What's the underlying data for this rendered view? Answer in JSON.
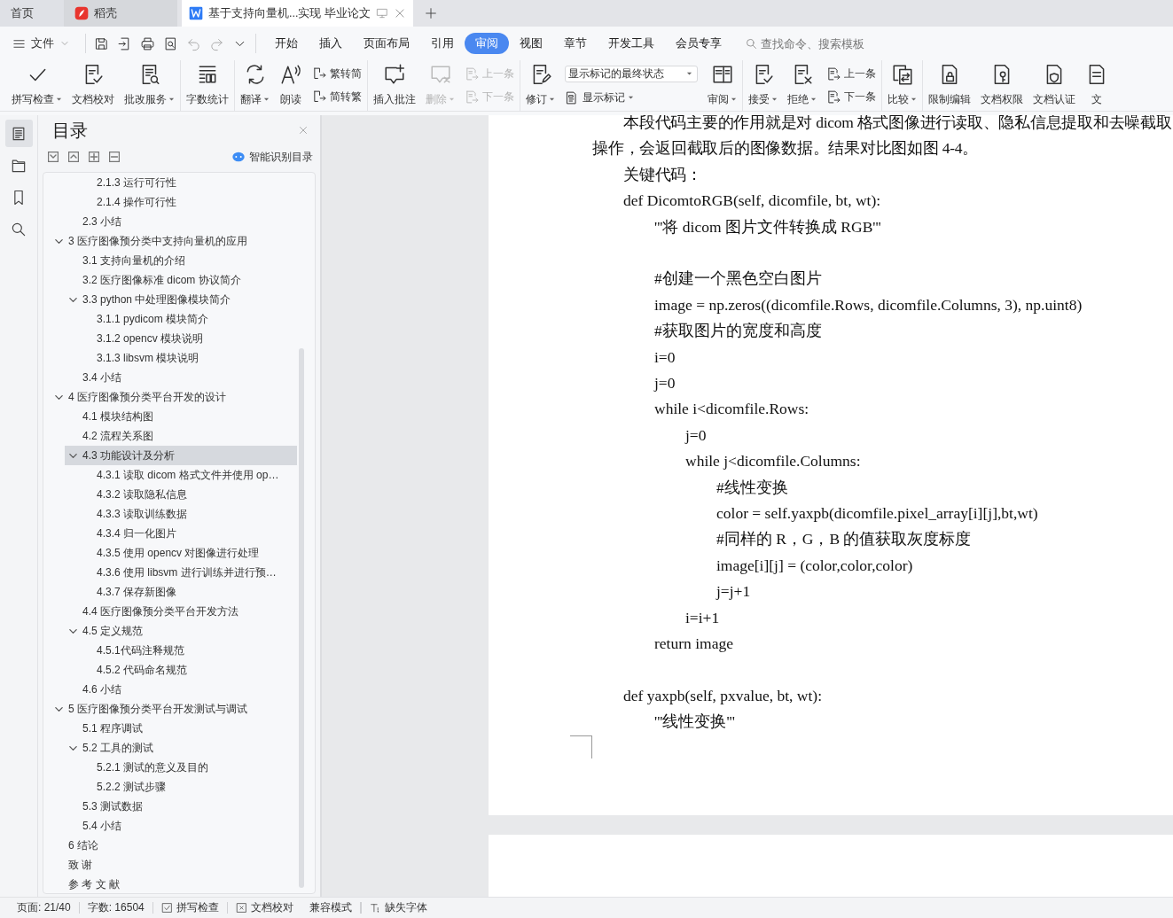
{
  "tabs": [
    {
      "label": "首页",
      "kind": "home",
      "selected": false
    },
    {
      "label": "稻壳",
      "kind": "docer",
      "selected": false
    },
    {
      "label": "基于支持向量机...实现 毕业论文",
      "kind": "doc",
      "selected": true
    }
  ],
  "menu": {
    "file": "文件",
    "tabs": [
      {
        "label": "开始",
        "selected": false
      },
      {
        "label": "插入",
        "selected": false
      },
      {
        "label": "页面布局",
        "selected": false
      },
      {
        "label": "引用",
        "selected": false
      },
      {
        "label": "审阅",
        "selected": true
      },
      {
        "label": "视图",
        "selected": false
      },
      {
        "label": "章节",
        "selected": false
      },
      {
        "label": "开发工具",
        "selected": false
      },
      {
        "label": "会员专享",
        "selected": false
      }
    ],
    "search": {
      "placeholder": "查找命令、搜索模板"
    }
  },
  "ribbon": {
    "groups": [
      {
        "tools": [
          {
            "kind": "large",
            "label": "拼写检查",
            "dropdown": true,
            "disabled": false
          },
          {
            "kind": "large",
            "label": "文档校对",
            "dropdown": false,
            "disabled": false
          },
          {
            "kind": "large",
            "label": "批改服务",
            "dropdown": true,
            "disabled": false
          }
        ]
      },
      {
        "tools": [
          {
            "kind": "large",
            "label": "字数统计",
            "dropdown": false,
            "disabled": false
          }
        ]
      },
      {
        "tools": [
          {
            "kind": "large",
            "label": "翻译",
            "dropdown": true,
            "disabled": false
          },
          {
            "kind": "large",
            "label": "朗读",
            "dropdown": false,
            "disabled": false
          },
          {
            "kind": "stack",
            "items": [
              {
                "kind": "small",
                "label": "繁转简",
                "dropdown": false,
                "disabled": false
              },
              {
                "kind": "small",
                "label": "简转繁",
                "dropdown": false,
                "disabled": false
              }
            ]
          }
        ]
      },
      {
        "tools": [
          {
            "kind": "large",
            "label": "插入批注",
            "dropdown": false,
            "disabled": false
          },
          {
            "kind": "large",
            "label": "删除",
            "dropdown": true,
            "disabled": true
          },
          {
            "kind": "stack",
            "items": [
              {
                "kind": "small",
                "label": "上一条",
                "dropdown": false,
                "disabled": true
              },
              {
                "kind": "small",
                "label": "下一条",
                "dropdown": false,
                "disabled": true
              }
            ]
          }
        ]
      },
      {
        "tools": [
          {
            "kind": "large",
            "label": "修订",
            "dropdown": true,
            "disabled": false
          },
          {
            "kind": "stack",
            "items": [
              {
                "kind": "select",
                "value": "显示标记的最终状态"
              },
              {
                "kind": "small",
                "label": "显示标记",
                "dropdown": true,
                "disabled": false
              }
            ]
          },
          {
            "kind": "large",
            "label": "审阅",
            "dropdown": true,
            "disabled": false
          }
        ]
      },
      {
        "tools": [
          {
            "kind": "large",
            "label": "接受",
            "dropdown": true,
            "disabled": false
          },
          {
            "kind": "large",
            "label": "拒绝",
            "dropdown": true,
            "disabled": false
          },
          {
            "kind": "stack",
            "items": [
              {
                "kind": "small",
                "label": "上一条",
                "dropdown": false,
                "disabled": false
              },
              {
                "kind": "small",
                "label": "下一条",
                "dropdown": false,
                "disabled": false
              }
            ]
          }
        ]
      },
      {
        "tools": [
          {
            "kind": "large",
            "label": "比较",
            "dropdown": true,
            "disabled": false
          }
        ]
      },
      {
        "tools": [
          {
            "kind": "large",
            "label": "限制编辑",
            "dropdown": false,
            "disabled": false
          },
          {
            "kind": "large",
            "label": "文档权限",
            "dropdown": false,
            "disabled": false
          },
          {
            "kind": "large",
            "label": "文档认证",
            "dropdown": false,
            "disabled": false
          },
          {
            "kind": "large",
            "label": "文",
            "dropdown": false,
            "disabled": false
          }
        ]
      }
    ]
  },
  "nav": [
    {
      "selected": true
    },
    {
      "selected": false
    },
    {
      "selected": false
    },
    {
      "selected": false
    }
  ],
  "toc": {
    "title": "目录",
    "smart": "智能识别目录",
    "items": [
      {
        "children": [
          {
            "children": [
              {
                "label": "2.1.3 运行可行性",
                "selected": false
              },
              {
                "label": "2.1.4 操作可行性",
                "selected": false
              }
            ]
          },
          {
            "label": "2.3 小结",
            "selected": false
          }
        ]
      },
      {
        "label": "3 医疗图像预分类中支持向量机的应用",
        "selected": false,
        "expanded": true,
        "children": [
          {
            "label": "3.1 支持向量机的介绍",
            "selected": false
          },
          {
            "label": "3.2 医疗图像标准 dicom 协议简介",
            "selected": false
          },
          {
            "label": "3.3 python 中处理图像模块简介",
            "selected": false,
            "expanded": true,
            "children": [
              {
                "label": "3.1.1 pydicom 模块简介",
                "selected": false
              },
              {
                "label": "3.1.2 opencv 模块说明",
                "selected": false
              },
              {
                "label": "3.1.3 libsvm 模块说明",
                "selected": false
              }
            ]
          },
          {
            "label": "3.4 小结",
            "selected": false
          }
        ]
      },
      {
        "label": "4 医疗图像预分类平台开发的设计",
        "selected": false,
        "expanded": true,
        "children": [
          {
            "label": "4.1 模块结构图",
            "selected": false
          },
          {
            "label": "4.2 流程关系图",
            "selected": false
          },
          {
            "label": "4.3 功能设计及分析",
            "selected": true,
            "expanded": true,
            "children": [
              {
                "label": "4.3.1 读取 dicom 格式文件并使用 op…",
                "selected": false
              },
              {
                "label": "4.3.2 读取隐私信息",
                "selected": false
              },
              {
                "label": "4.3.3 读取训练数据",
                "selected": false
              },
              {
                "label": "4.3.4 归一化图片",
                "selected": false
              },
              {
                "label": "4.3.5 使用 opencv 对图像进行处理",
                "selected": false
              },
              {
                "label": "4.3.6 使用 libsvm 进行训练并进行预…",
                "selected": false
              },
              {
                "label": "4.3.7 保存新图像",
                "selected": false
              }
            ]
          },
          {
            "label": "4.4 医疗图像预分类平台开发方法",
            "selected": false
          },
          {
            "label": "4.5 定义规范",
            "selected": false,
            "expanded": true,
            "children": [
              {
                "label": "4.5.1代码注释规范",
                "selected": false
              },
              {
                "label": "4.5.2 代码命名规范",
                "selected": false
              }
            ]
          },
          {
            "label": "4.6 小结",
            "selected": false
          }
        ]
      },
      {
        "label": "5 医疗图像预分类平台开发测试与调试",
        "selected": false,
        "expanded": true,
        "children": [
          {
            "label": "5.1 程序调试",
            "selected": false
          },
          {
            "label": "5.2 工具的测试",
            "selected": false,
            "expanded": true,
            "children": [
              {
                "label": "5.2.1 测试的意义及目的",
                "selected": false
              },
              {
                "label": "5.2.2 测试步骤",
                "selected": false
              }
            ]
          },
          {
            "label": "5.3 测试数据",
            "selected": false
          },
          {
            "label": "5.4 小结",
            "selected": false
          }
        ]
      },
      {
        "label": "6 结论",
        "selected": false
      },
      {
        "label": "致 谢",
        "selected": false
      },
      {
        "label": "参 考 文 献",
        "selected": false
      }
    ]
  },
  "document": {
    "lines": [
      {
        "kind": "para",
        "text": "本段代码主要的作用就是对 dicom 格式图像进行读取、隐私信息提取和去噪截取操作，会返回截取后的图像数据。结果对比图如图 4-4。"
      },
      {
        "kind": "para",
        "text": "关键代码："
      },
      {
        "kind": "code",
        "text": "def DicomtoRGB(self, dicomfile, bt, wt):",
        "children": [
          {
            "kind": "code",
            "text": "'''将 dicom 图片文件转换成 RGB'''"
          },
          {
            "kind": "blank"
          },
          {
            "kind": "code",
            "text": "#创建一个黑色空白图片"
          },
          {
            "kind": "code",
            "text": "image = np.zeros((dicomfile.Rows, dicomfile.Columns, 3), np.uint8)"
          },
          {
            "kind": "code",
            "text": "#获取图片的宽度和高度"
          },
          {
            "kind": "code",
            "text": "i=0"
          },
          {
            "kind": "code",
            "text": "j=0"
          },
          {
            "kind": "code",
            "text": "while i<dicomfile.Rows:",
            "children": [
              {
                "kind": "code",
                "text": "j=0"
              },
              {
                "kind": "code",
                "text": "while j<dicomfile.Columns:",
                "children": [
                  {
                    "kind": "code",
                    "text": "#线性变换"
                  },
                  {
                    "kind": "code",
                    "text": "color = self.yaxpb(dicomfile.pixel_array[i][j],bt,wt)"
                  },
                  {
                    "kind": "code",
                    "text": "#同样的 R，G，B 的值获取灰度标度"
                  },
                  {
                    "kind": "code",
                    "text": "image[i][j] = (color,color,color)"
                  },
                  {
                    "kind": "code",
                    "text": "j=j+1"
                  }
                ]
              },
              {
                "kind": "code",
                "text": "i=i+1"
              }
            ]
          },
          {
            "kind": "code",
            "text": "return image"
          }
        ]
      },
      {
        "kind": "blank"
      },
      {
        "kind": "code",
        "text": "def yaxpb(self, pxvalue, bt, wt):",
        "children": [
          {
            "kind": "code",
            "text": "'''线性变换'''"
          }
        ]
      }
    ]
  },
  "status": {
    "page": "页面: 21/40",
    "words": "字数: 16504",
    "items": [
      {
        "kind": "check",
        "label": "拼写检查"
      },
      {
        "kind": "xbox",
        "label": "文档校对"
      },
      {
        "kind": "plain",
        "label": "兼容模式"
      },
      {
        "kind": "font",
        "label": "缺失字体"
      }
    ]
  }
}
